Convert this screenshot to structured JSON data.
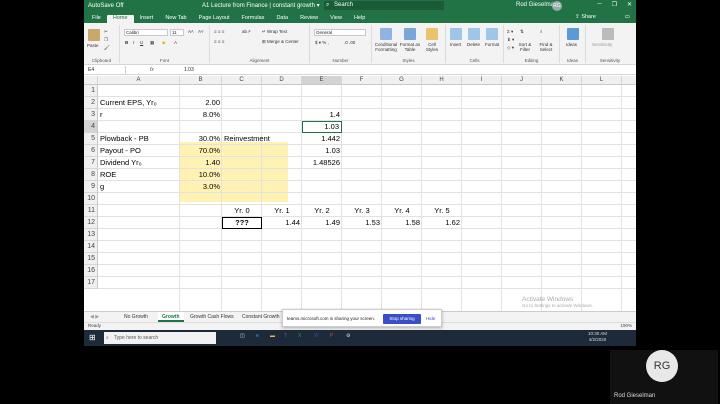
{
  "window": {
    "autosave": "AutoSave",
    "autosave_state": "Off",
    "title": "A1 Lecture from Finance | constant growth ▾",
    "search_placeholder": "Search",
    "user": "Rod Gieselman",
    "avatar": "RG"
  },
  "menu": {
    "tabs": [
      "File",
      "Home",
      "Insert",
      "New Tab",
      "Page Layout",
      "Formulas",
      "Data",
      "Review",
      "View",
      "Help"
    ],
    "share": "Share",
    "comments": "Comments"
  },
  "ribbon": {
    "clipboard": "Clipboard",
    "paste": "Paste",
    "font": "Font",
    "font_name": "Calibri",
    "font_size": "11",
    "alignment": "Alignment",
    "wrap_text": "Wrap Text",
    "merge_center": "Merge & Center",
    "number": "Number",
    "number_format": "General",
    "styles": "Styles",
    "conditional": "Conditional Formatting",
    "format_table": "Format as Table",
    "cell_styles": "Cell Styles",
    "cells": "Cells",
    "insert": "Insert",
    "delete": "Delete",
    "format": "Format",
    "editing": "Editing",
    "sort_filter": "Sort & Filter",
    "find_select": "Find & Select",
    "ideas_group": "Ideas",
    "ideas": "Ideas",
    "sensitivity_group": "Sensitivity",
    "sensitivity": "Sensitivity"
  },
  "formula_bar": {
    "name_box": "E4",
    "fx": "fx",
    "value": "1.03"
  },
  "columns": [
    "A",
    "B",
    "C",
    "D",
    "E",
    "F",
    "G",
    "H",
    "I",
    "J",
    "K",
    "L",
    "M"
  ],
  "rows": [
    "1",
    "2",
    "3",
    "4",
    "5",
    "6",
    "7",
    "8",
    "9",
    "10",
    "11",
    "12",
    "13",
    "14",
    "15",
    "16",
    "17"
  ],
  "cells": {
    "A2": "Current EPS, Yr₀",
    "B2": "2.00",
    "A3": "r",
    "B3": "8.0%",
    "E3": "1.4",
    "E4": "1.03",
    "A5": "Plowback - PB",
    "B5": "30.0%",
    "C5": "Reinvestment",
    "E5": "1.442",
    "A6": "Payout - PO",
    "B6": "70.0%",
    "E6": "1.03",
    "A7": "Dividend Yr₀",
    "B7": "1.40",
    "E7": "1.48526",
    "A8": "ROE",
    "B8": "10.0%",
    "A9": "g",
    "B9": "3.0%",
    "C11": "Yr. 0",
    "D11": "Yr. 1",
    "E11": "Yr. 2",
    "F11": "Yr. 3",
    "G11": "Yr. 4",
    "H11": "Yr. 5",
    "C12": "???",
    "D12": "1.44",
    "E12": "1.49",
    "F12": "1.53",
    "G12": "1.58",
    "H12": "1.62"
  },
  "sheets": [
    "No Growth",
    "Growth",
    "Growth Cash Flows",
    "Constant Growth"
  ],
  "active_sheet": "Growth",
  "status": {
    "ready": "Ready",
    "zoom": "190%"
  },
  "share_notice": {
    "text": "teams.microsoft.com is sharing your screen.",
    "stop": "Stop sharing",
    "hide": "Hide"
  },
  "watermark": {
    "title": "Activate Windows",
    "subtitle": "Go to Settings to activate Windows."
  },
  "taskbar": {
    "search": "Type here to search",
    "time": "10:30 AM",
    "date": "4/2/2020"
  },
  "video": {
    "initials": "RG",
    "name": "Rod Gieselman"
  },
  "colors": {
    "excel_green": "#217346",
    "highlight": "#fff2b3"
  }
}
